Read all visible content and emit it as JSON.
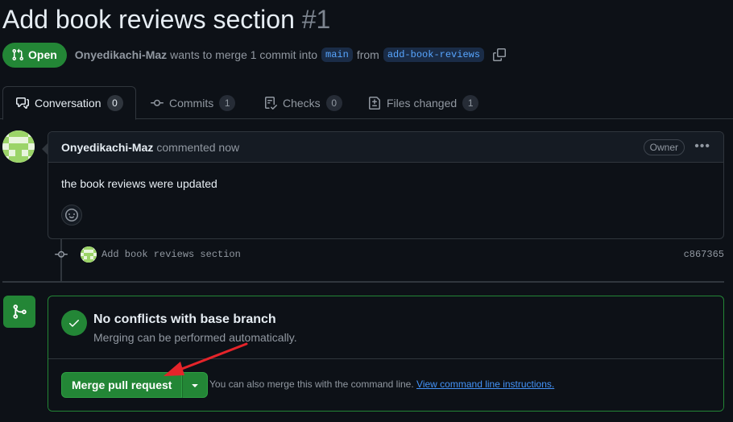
{
  "pr": {
    "title": "Add book reviews section",
    "number": "#1",
    "state": "Open",
    "author": "Onyedikachi-Maz",
    "merge_text_1": "wants to merge 1 commit into",
    "base_branch": "main",
    "merge_text_2": "from",
    "head_branch": "add-book-reviews"
  },
  "tabs": [
    {
      "label": "Conversation",
      "count": "0",
      "icon": "comment-discussion-icon",
      "active": true
    },
    {
      "label": "Commits",
      "count": "1",
      "icon": "git-commit-icon"
    },
    {
      "label": "Checks",
      "count": "0",
      "icon": "checklist-icon"
    },
    {
      "label": "Files changed",
      "count": "1",
      "icon": "file-diff-icon"
    }
  ],
  "comment": {
    "author": "Onyedikachi-Maz",
    "action": "commented now",
    "badge": "Owner",
    "body": "the book reviews were updated"
  },
  "commit": {
    "message": "Add book reviews section",
    "sha": "c867365"
  },
  "merge": {
    "status_title": "No conflicts with base branch",
    "status_subtitle": "Merging can be performed automatically.",
    "button_label": "Merge pull request",
    "cli_text": "You can also merge this with the command line.",
    "cli_link": "View command line instructions."
  },
  "colors": {
    "background": "#0d1117",
    "accent_green": "#238636",
    "link_blue": "#4493f8",
    "annotation_red": "#e5242a"
  }
}
